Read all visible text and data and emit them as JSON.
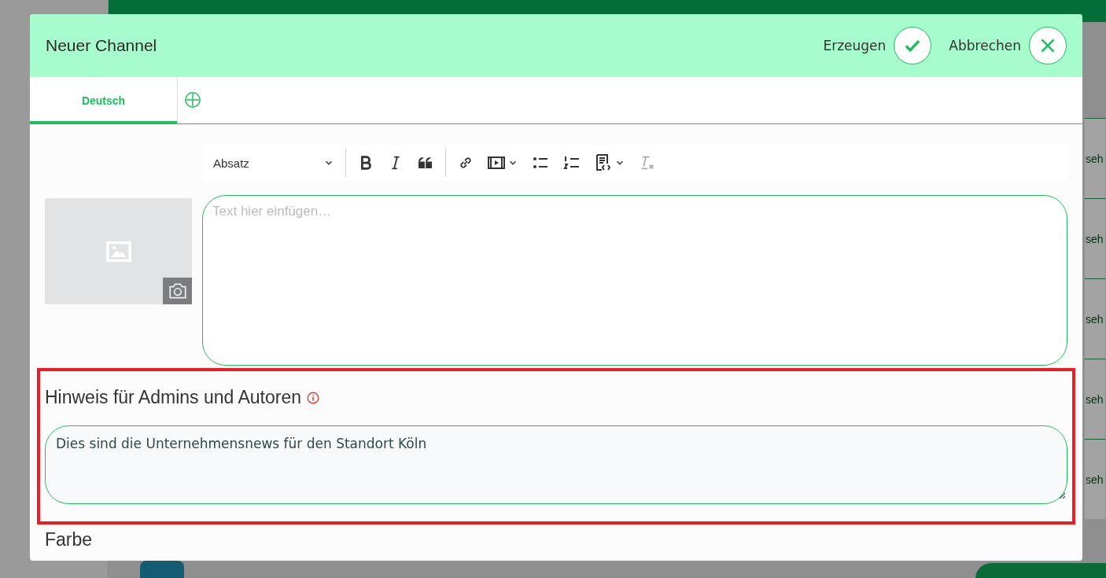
{
  "dialog": {
    "title": "Neuer Channel",
    "actions": [
      {
        "label": "Erzeugen",
        "kind": "confirm"
      },
      {
        "label": "Abbrechen",
        "kind": "cancel"
      }
    ],
    "tabs": [
      {
        "label": "Deutsch",
        "selected": true
      }
    ],
    "editor": {
      "block_format": "Absatz",
      "placeholder": "Text hier einfügen…"
    },
    "admin_note": {
      "label": "Hinweis für Admins und Autoren",
      "value": "Dies sind die Unternehmensnews für den Standort Köln",
      "highlighted": true
    },
    "color_section": {
      "label": "Farbe"
    }
  },
  "background": {
    "links": [
      "seh",
      "seh",
      "seh",
      "seh",
      "seh"
    ]
  }
}
